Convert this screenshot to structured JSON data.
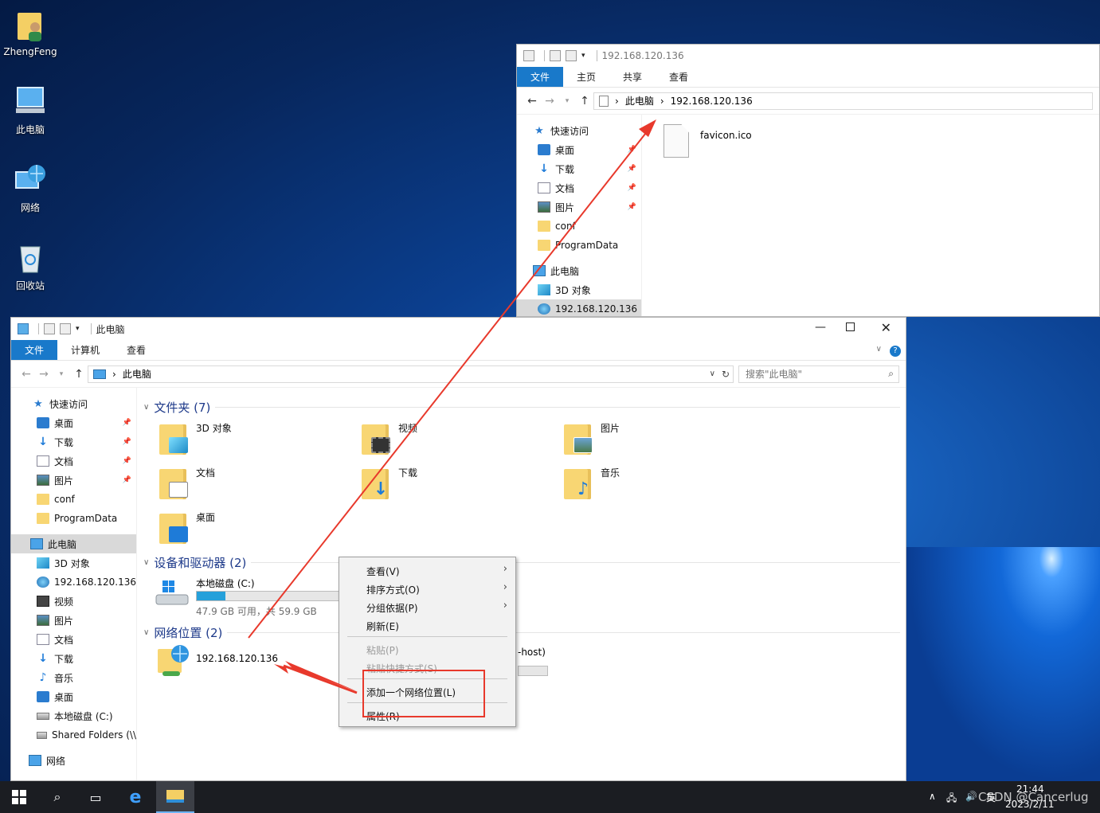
{
  "desktop": {
    "icons": [
      {
        "label": "ZhengFeng",
        "icon": "user-folder-icon"
      },
      {
        "label": "此电脑",
        "icon": "computer-icon"
      },
      {
        "label": "网络",
        "icon": "network-icon"
      },
      {
        "label": "回收站",
        "icon": "recycle-bin-icon"
      }
    ]
  },
  "back_window": {
    "title": "192.168.120.136",
    "ribbon_tabs": [
      "文件",
      "主页",
      "共享",
      "查看"
    ],
    "breadcrumb": [
      "此电脑",
      "192.168.120.136"
    ],
    "nav": {
      "quick_access": "快速访问",
      "items": [
        "桌面",
        "下载",
        "文档",
        "图片",
        "conf",
        "ProgramData"
      ],
      "this_pc": "此电脑",
      "pc_items": [
        "3D 对象",
        "192.168.120.136"
      ]
    },
    "files": [
      {
        "name": "favicon.ico",
        "icon": "file-icon"
      }
    ]
  },
  "front_window": {
    "title": "此电脑",
    "ribbon_tabs": [
      "文件",
      "计算机",
      "查看"
    ],
    "breadcrumb": [
      "此电脑"
    ],
    "search_placeholder": "搜索\"此电脑\"",
    "nav": {
      "quick_access": "快速访问",
      "items": [
        "桌面",
        "下载",
        "文档",
        "图片",
        "conf",
        "ProgramData"
      ],
      "this_pc": "此电脑",
      "pc_items": [
        "3D 对象",
        "192.168.120.136",
        "视频",
        "图片",
        "文档",
        "下载",
        "音乐",
        "桌面",
        "本地磁盘 (C:)",
        "Shared Folders (\\\\"
      ],
      "network": "网络"
    },
    "groups": {
      "folders": "文件夹 (7)",
      "devices": "设备和驱动器 (2)",
      "network": "网络位置 (2)"
    },
    "folders": [
      "3D 对象",
      "视频",
      "图片",
      "文档",
      "下载",
      "音乐",
      "桌面"
    ],
    "drive": {
      "name": "本地磁盘 (C:)",
      "free": "47.9 GB 可用，共 59.9 GB",
      "used_fraction": 0.2
    },
    "network_locations": [
      "192.168.120.136",
      "-host)"
    ]
  },
  "context_menu": {
    "items": [
      {
        "label": "查看(V)",
        "submenu": true,
        "disabled": false
      },
      {
        "label": "排序方式(O)",
        "submenu": true,
        "disabled": false
      },
      {
        "label": "分组依据(P)",
        "submenu": true,
        "disabled": false
      },
      {
        "label": "刷新(E)",
        "submenu": false,
        "disabled": false
      },
      {
        "label": "粘贴(P)",
        "submenu": false,
        "disabled": true
      },
      {
        "label": "粘贴快捷方式(S)",
        "submenu": false,
        "disabled": true
      },
      {
        "label": "添加一个网络位置(L)",
        "submenu": false,
        "disabled": false
      },
      {
        "label": "属性(R)",
        "submenu": false,
        "disabled": false
      }
    ]
  },
  "taskbar": {
    "time": "21:44",
    "date": "2023/2/11",
    "ime": "英",
    "watermark": "CSDN @Cancerlug"
  },
  "colors": {
    "accent": "#1979ca",
    "annotation": "#e8392c"
  }
}
